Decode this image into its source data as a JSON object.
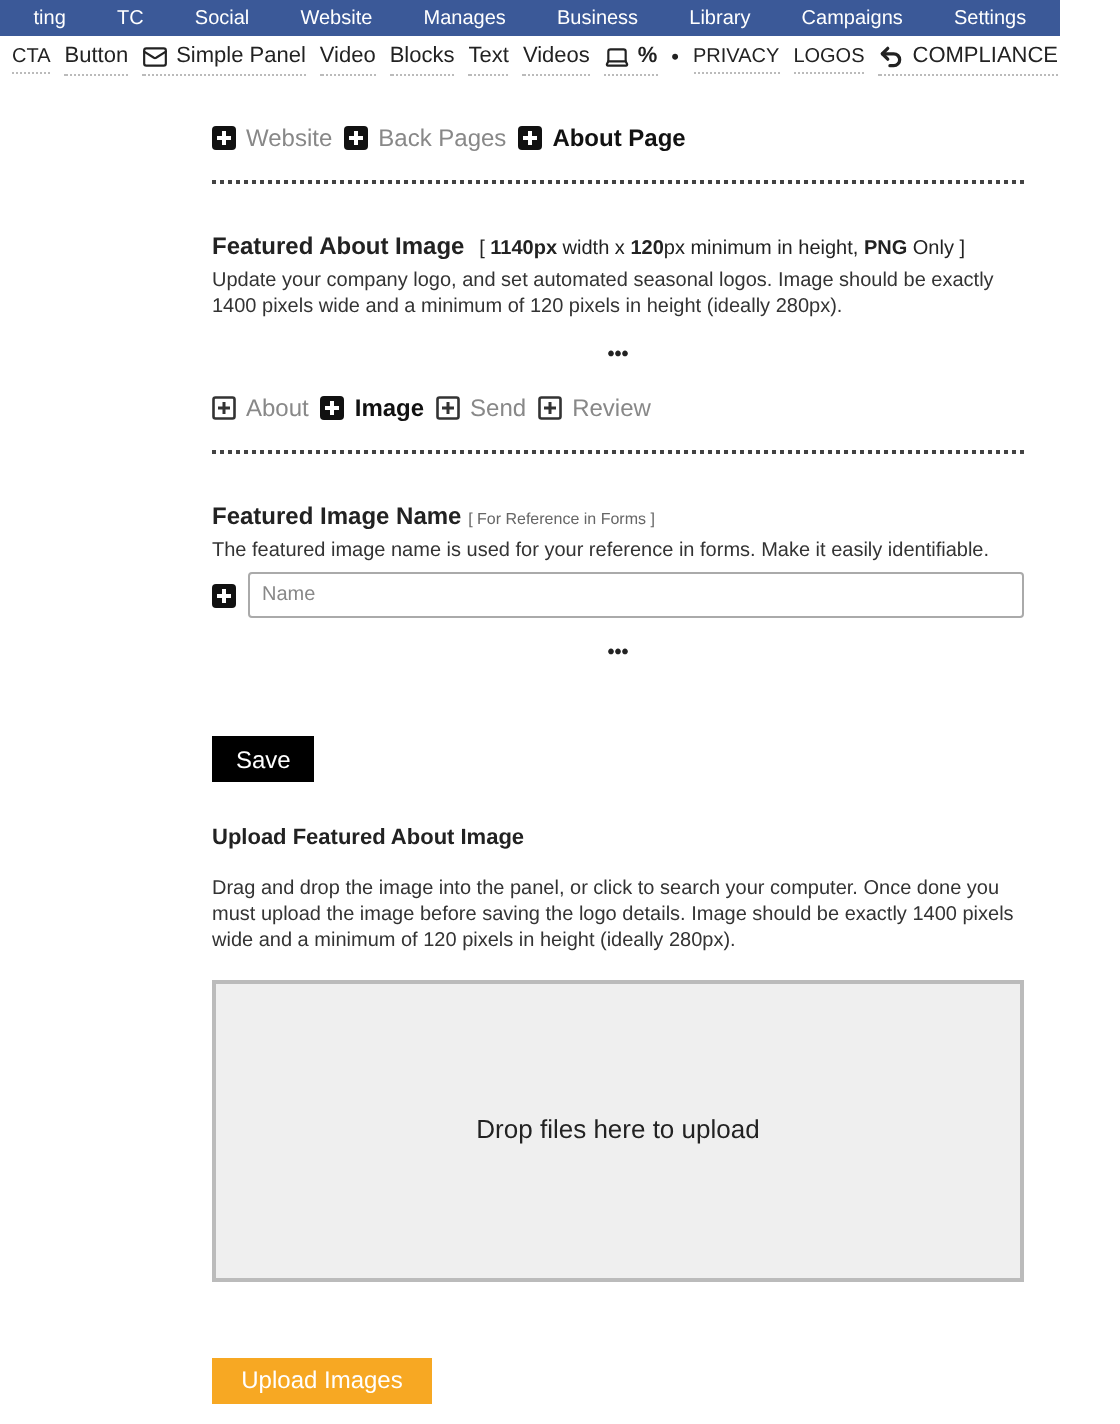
{
  "top_nav": [
    "ting",
    "TC",
    "Social",
    "Website",
    "Manages",
    "Business",
    "Library",
    "Campaigns",
    "Settings"
  ],
  "toolbar": [
    {
      "label": "CTA",
      "kind": "text"
    },
    {
      "label": "Button",
      "kind": "text"
    },
    {
      "label": "Simple Panel",
      "kind": "mail"
    },
    {
      "label": "Video",
      "kind": "text"
    },
    {
      "label": "Blocks",
      "kind": "text"
    },
    {
      "label": "Text",
      "kind": "text"
    },
    {
      "label": "Videos",
      "kind": "text"
    },
    {
      "label": "%",
      "kind": "laptop"
    },
    {
      "label": "•",
      "kind": "bullet"
    },
    {
      "label": "PRIVACY",
      "kind": "text"
    },
    {
      "label": "LOGOS",
      "kind": "text"
    },
    {
      "label": "COMPLIANCE",
      "kind": "undo"
    }
  ],
  "page_tabs": [
    {
      "label": "Website",
      "selected": false
    },
    {
      "label": "Back Pages",
      "selected": false
    },
    {
      "label": "About Page",
      "selected": true
    }
  ],
  "featured_image": {
    "title": "Featured About Image",
    "spec": "[ **1140px** width x **120**px minimum in height, **PNG** Only ]",
    "description": "Update your company logo, and set automated seasonal logos. Image should be exactly 1400 pixels wide and a minimum of 120 pixels in height (ideally 280px).",
    "more": "•••"
  },
  "step_tabs": [
    {
      "label": "About",
      "selected": false
    },
    {
      "label": "Image",
      "selected": true
    },
    {
      "label": "Send",
      "selected": false
    },
    {
      "label": "Review",
      "selected": false
    }
  ],
  "image_name": {
    "title": "Featured Image Name",
    "note": "[ For Reference in Forms ]",
    "description": "The featured image name is used for your reference in forms. Make it easily identifiable.",
    "placeholder": "Name",
    "more": "•••"
  },
  "save_button": "Save",
  "upload": {
    "title": "Upload Featured About Image",
    "description": "Drag and drop the image into the panel, or click to search your computer. Once done you must upload the image before saving the logo details. Image should be exactly 1400 pixels wide and a minimum of 120 pixels in height (ideally 280px).",
    "dropzone": "Drop files here to upload",
    "button": "Upload Images"
  }
}
